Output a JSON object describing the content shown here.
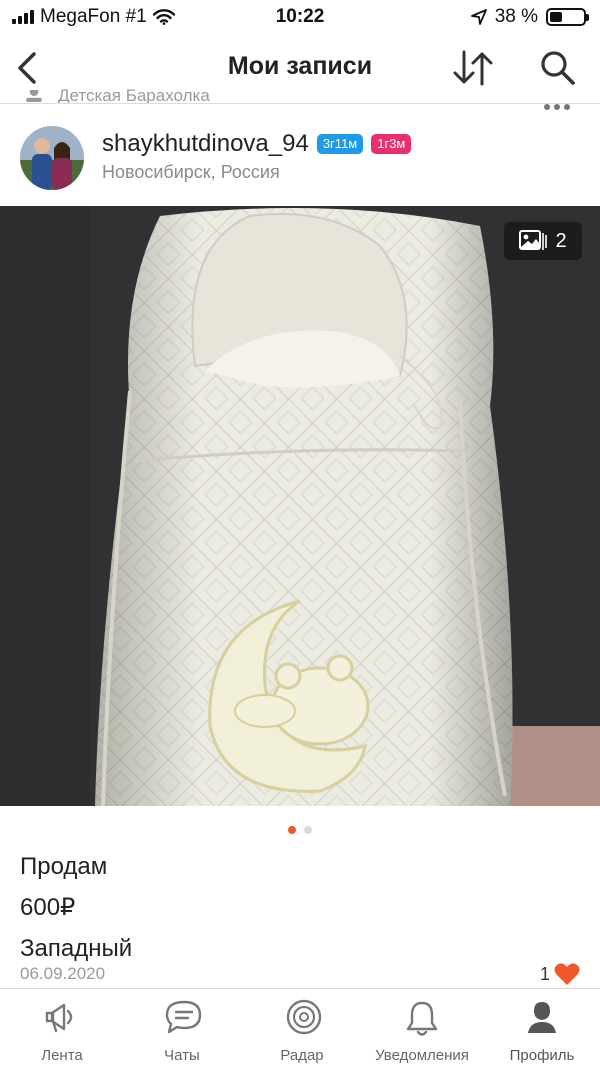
{
  "status_bar": {
    "carrier": "MegaFon #1",
    "time": "10:22",
    "battery": "38 %",
    "battery_level": 0.38
  },
  "nav": {
    "title": "Мои записи",
    "back_icon": "chevron-left-icon",
    "sort_icon": "sort-arrows-icon",
    "search_icon": "search-icon"
  },
  "prev_item": {
    "text": "Детская Барахолка"
  },
  "post": {
    "username": "shaykhutdinova_94",
    "badges": [
      "3г11м",
      "1г3м"
    ],
    "location": "Новосибирск, Россия",
    "photo_count": "2",
    "text_lines": [
      "Продам",
      "600₽",
      "Западный"
    ],
    "date": "06.09.2020",
    "likes": "1"
  },
  "colors": {
    "badge_blue": "#1e9ae6",
    "badge_pink": "#e8306a",
    "like_heart": "#f0582a",
    "dot_active": "#f0582a",
    "dot_inactive": "#d9d9d9"
  },
  "tab_bar": {
    "items": [
      {
        "label": "Лента",
        "icon": "megaphone-icon"
      },
      {
        "label": "Чаты",
        "icon": "chat-bubble-icon"
      },
      {
        "label": "Радар",
        "icon": "radar-icon"
      },
      {
        "label": "Уведомления",
        "icon": "bell-icon"
      },
      {
        "label": "Профиль",
        "icon": "profile-icon"
      }
    ]
  }
}
